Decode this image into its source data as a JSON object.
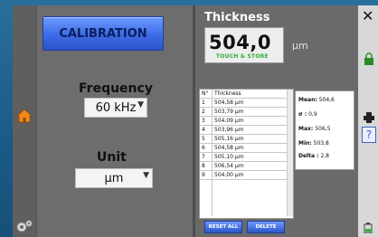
{
  "calibration": {
    "label": "CALIBRATION"
  },
  "frequency": {
    "label": "Frequency",
    "value": "60 kHz"
  },
  "unit": {
    "label": "Unit",
    "value": "µm"
  },
  "thickness": {
    "title": "Thickness",
    "value": "504,0",
    "hint": "TOUCH & STORE",
    "unit": "µm"
  },
  "table": {
    "headers": [
      "N°",
      "Thickness"
    ],
    "rows": [
      {
        "n": "1",
        "v": "504,58 µm"
      },
      {
        "n": "2",
        "v": "503,79 µm"
      },
      {
        "n": "3",
        "v": "504,09 µm"
      },
      {
        "n": "4",
        "v": "503,96 µm"
      },
      {
        "n": "5",
        "v": "505,16 µm"
      },
      {
        "n": "6",
        "v": "504,58 µm"
      },
      {
        "n": "7",
        "v": "505,10 µm"
      },
      {
        "n": "8",
        "v": "506,54 µm"
      },
      {
        "n": "9",
        "v": "504,00 µm"
      }
    ]
  },
  "stats": {
    "mean_label": "Mean:",
    "mean": "504,6",
    "sigma_label": "σ :",
    "sigma": "0,9",
    "max_label": "Max:",
    "max": "506,5",
    "min_label": "Min:",
    "min": "503,8",
    "delta_label": "Delta :",
    "delta": "2,8"
  },
  "buttons": {
    "reset": "RESET ALL",
    "delete": "DELETE"
  },
  "colors": {
    "accent": "#3d6be6",
    "touch": "#2fae3a"
  },
  "icons": {
    "home": "home-icon",
    "gear": "gear-icon",
    "close": "close-icon",
    "lock": "lock-icon",
    "print": "print-icon",
    "help": "help-icon",
    "battery": "battery-icon"
  }
}
